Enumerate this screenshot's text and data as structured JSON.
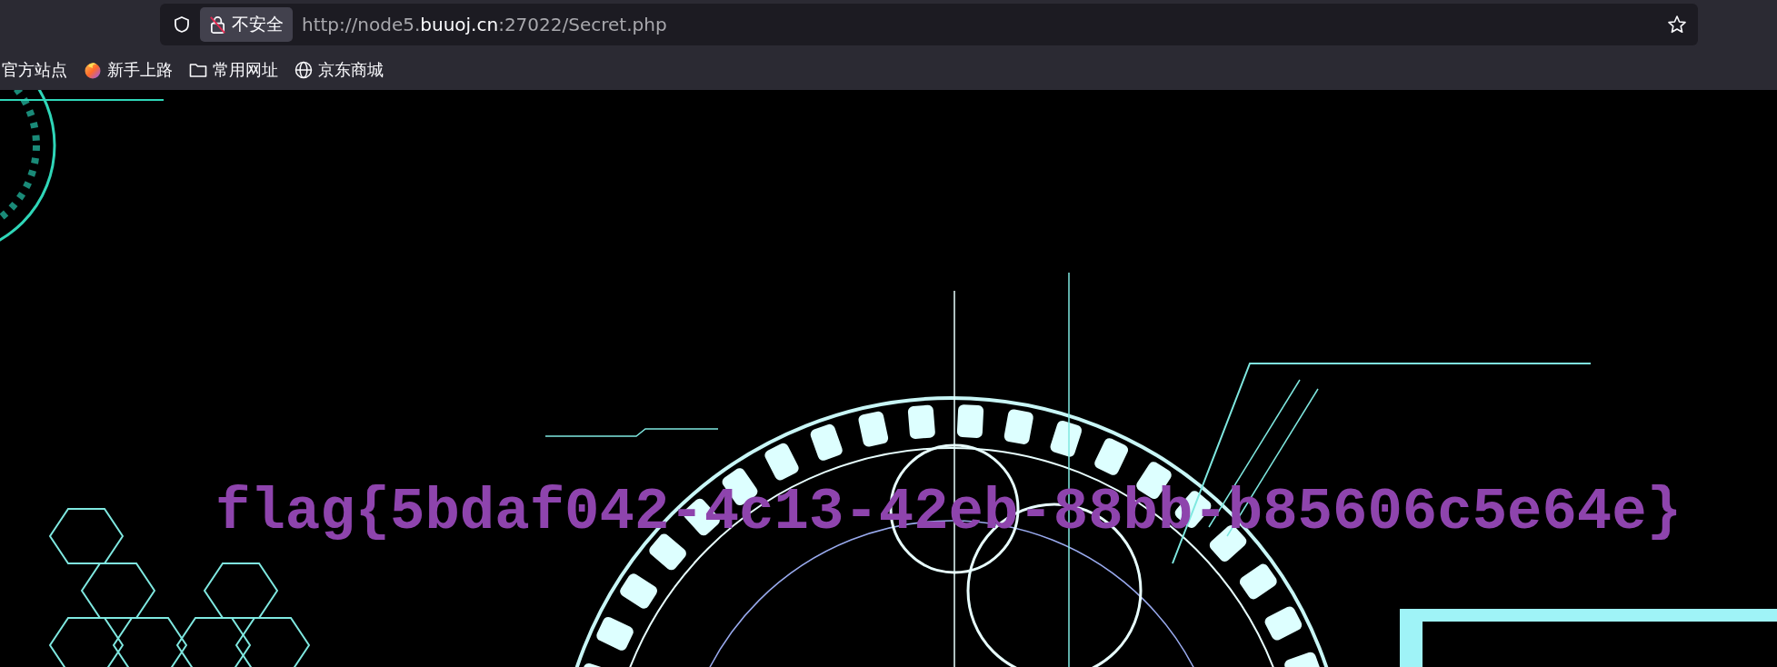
{
  "address_bar": {
    "security_label": "不安全",
    "url": "http://node5.**buuoj.cn**:27022/Secret.php"
  },
  "bookmarks": [
    {
      "label": "官方站点",
      "kind": "plain"
    },
    {
      "label": "新手上路",
      "kind": "app"
    },
    {
      "label": "常用网址",
      "kind": "folder"
    },
    {
      "label": "京东商城",
      "kind": "site"
    }
  ],
  "page": {
    "flag_text": "flag{5bdaf042-4c13-42eb-88bb-b85606c5e64e}"
  }
}
